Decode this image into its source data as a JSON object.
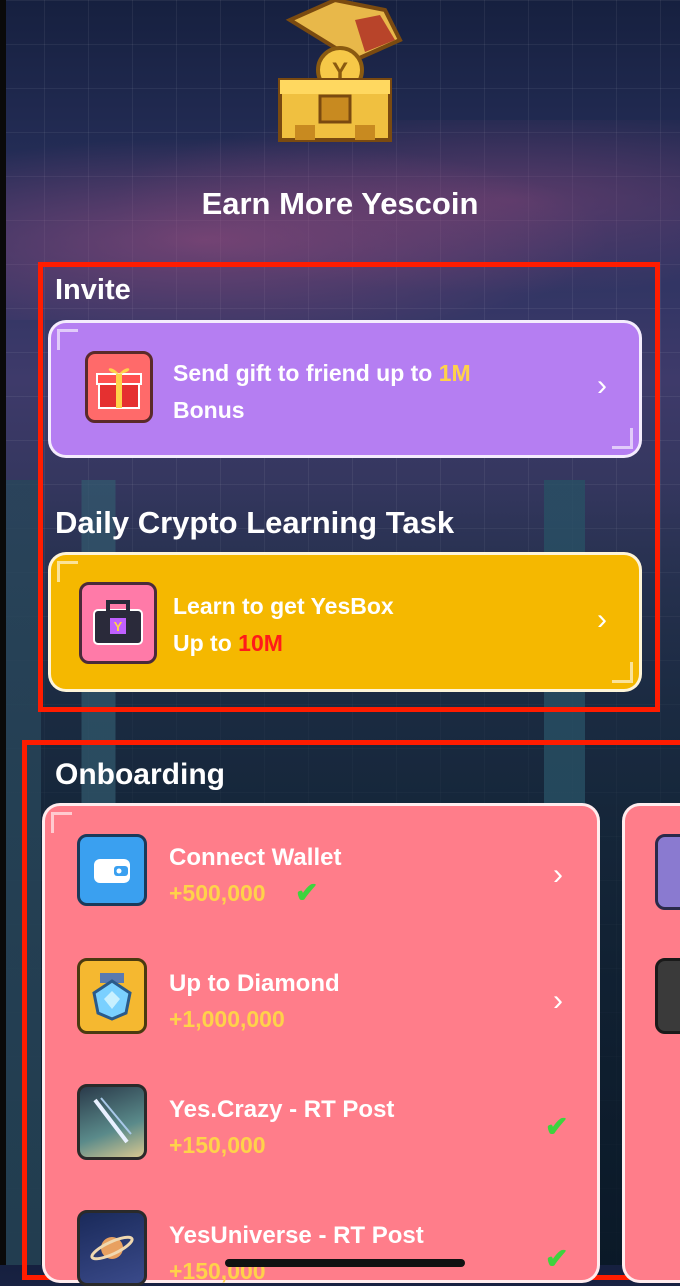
{
  "header": {
    "title": "Earn More Yescoin"
  },
  "invite": {
    "section_title": "Invite",
    "card": {
      "text_prefix": "Send gift to friend up to ",
      "highlight": "1M",
      "text_suffix": "Bonus"
    }
  },
  "learning": {
    "section_title": "Daily Crypto Learning Task",
    "card": {
      "line1": "Learn to get YesBox",
      "line2_prefix": "Up to ",
      "highlight": "10M"
    }
  },
  "onboarding": {
    "section_title": "Onboarding",
    "tasks": [
      {
        "name": "Connect Wallet",
        "reward": "+500,000",
        "completed": true
      },
      {
        "name": "Up to Diamond",
        "reward": "+1,000,000",
        "completed": false
      },
      {
        "name": "Yes.Crazy - RT Post",
        "reward": "+150,000",
        "completed": true
      },
      {
        "name": "YesUniverse - RT Post",
        "reward": "+150,000",
        "completed": true
      }
    ]
  },
  "colors": {
    "highlight_border": "#ff1c00",
    "invite_card": "#b57ef2",
    "learning_card": "#f5b800",
    "onboarding_card": "#ff7d8a",
    "reward_gold": "#ffd24a",
    "check_green": "#3ed33e"
  }
}
